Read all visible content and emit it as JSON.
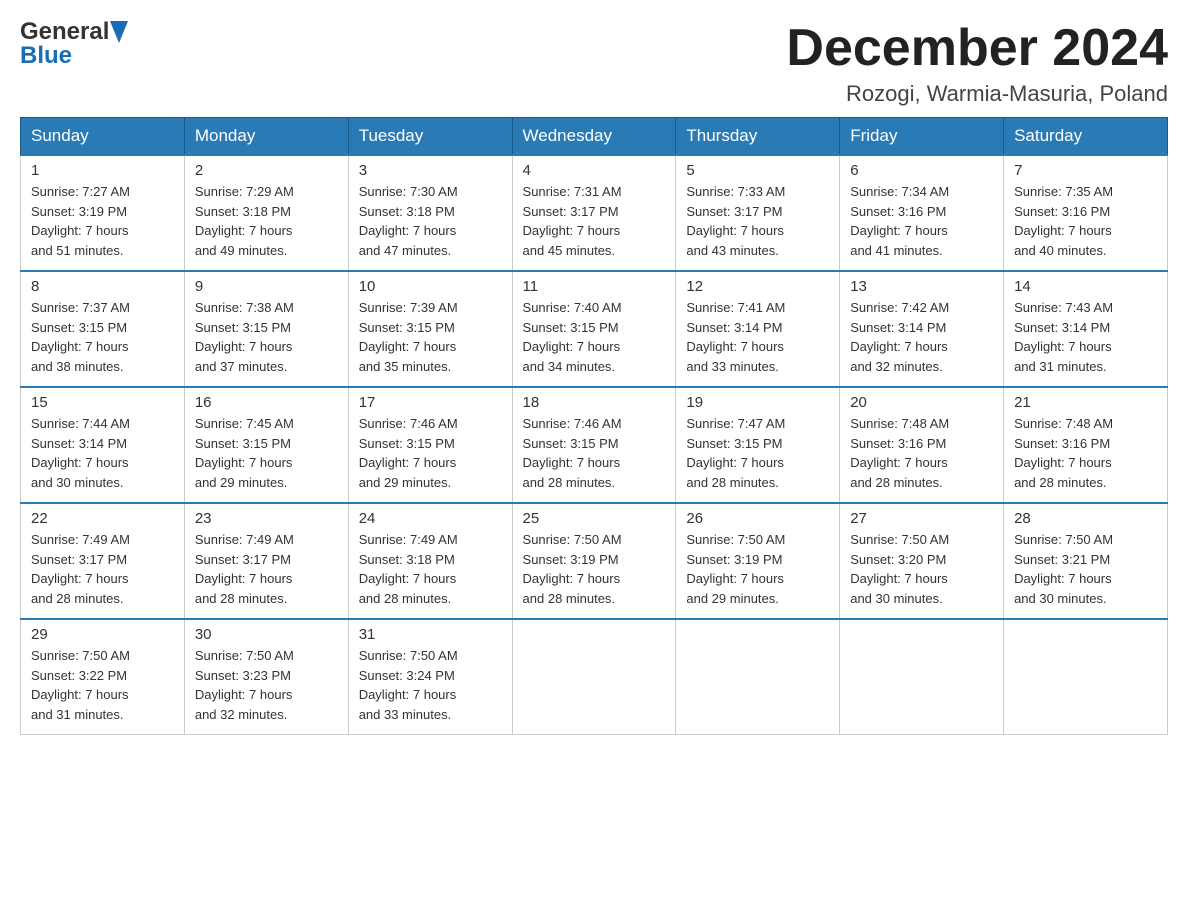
{
  "header": {
    "logo_general": "General",
    "logo_blue": "Blue",
    "month_title": "December 2024",
    "location": "Rozogi, Warmia-Masuria, Poland"
  },
  "weekdays": [
    "Sunday",
    "Monday",
    "Tuesday",
    "Wednesday",
    "Thursday",
    "Friday",
    "Saturday"
  ],
  "weeks": [
    [
      {
        "day": "1",
        "sunrise": "7:27 AM",
        "sunset": "3:19 PM",
        "daylight": "7 hours and 51 minutes."
      },
      {
        "day": "2",
        "sunrise": "7:29 AM",
        "sunset": "3:18 PM",
        "daylight": "7 hours and 49 minutes."
      },
      {
        "day": "3",
        "sunrise": "7:30 AM",
        "sunset": "3:18 PM",
        "daylight": "7 hours and 47 minutes."
      },
      {
        "day": "4",
        "sunrise": "7:31 AM",
        "sunset": "3:17 PM",
        "daylight": "7 hours and 45 minutes."
      },
      {
        "day": "5",
        "sunrise": "7:33 AM",
        "sunset": "3:17 PM",
        "daylight": "7 hours and 43 minutes."
      },
      {
        "day": "6",
        "sunrise": "7:34 AM",
        "sunset": "3:16 PM",
        "daylight": "7 hours and 41 minutes."
      },
      {
        "day": "7",
        "sunrise": "7:35 AM",
        "sunset": "3:16 PM",
        "daylight": "7 hours and 40 minutes."
      }
    ],
    [
      {
        "day": "8",
        "sunrise": "7:37 AM",
        "sunset": "3:15 PM",
        "daylight": "7 hours and 38 minutes."
      },
      {
        "day": "9",
        "sunrise": "7:38 AM",
        "sunset": "3:15 PM",
        "daylight": "7 hours and 37 minutes."
      },
      {
        "day": "10",
        "sunrise": "7:39 AM",
        "sunset": "3:15 PM",
        "daylight": "7 hours and 35 minutes."
      },
      {
        "day": "11",
        "sunrise": "7:40 AM",
        "sunset": "3:15 PM",
        "daylight": "7 hours and 34 minutes."
      },
      {
        "day": "12",
        "sunrise": "7:41 AM",
        "sunset": "3:14 PM",
        "daylight": "7 hours and 33 minutes."
      },
      {
        "day": "13",
        "sunrise": "7:42 AM",
        "sunset": "3:14 PM",
        "daylight": "7 hours and 32 minutes."
      },
      {
        "day": "14",
        "sunrise": "7:43 AM",
        "sunset": "3:14 PM",
        "daylight": "7 hours and 31 minutes."
      }
    ],
    [
      {
        "day": "15",
        "sunrise": "7:44 AM",
        "sunset": "3:14 PM",
        "daylight": "7 hours and 30 minutes."
      },
      {
        "day": "16",
        "sunrise": "7:45 AM",
        "sunset": "3:15 PM",
        "daylight": "7 hours and 29 minutes."
      },
      {
        "day": "17",
        "sunrise": "7:46 AM",
        "sunset": "3:15 PM",
        "daylight": "7 hours and 29 minutes."
      },
      {
        "day": "18",
        "sunrise": "7:46 AM",
        "sunset": "3:15 PM",
        "daylight": "7 hours and 28 minutes."
      },
      {
        "day": "19",
        "sunrise": "7:47 AM",
        "sunset": "3:15 PM",
        "daylight": "7 hours and 28 minutes."
      },
      {
        "day": "20",
        "sunrise": "7:48 AM",
        "sunset": "3:16 PM",
        "daylight": "7 hours and 28 minutes."
      },
      {
        "day": "21",
        "sunrise": "7:48 AM",
        "sunset": "3:16 PM",
        "daylight": "7 hours and 28 minutes."
      }
    ],
    [
      {
        "day": "22",
        "sunrise": "7:49 AM",
        "sunset": "3:17 PM",
        "daylight": "7 hours and 28 minutes."
      },
      {
        "day": "23",
        "sunrise": "7:49 AM",
        "sunset": "3:17 PM",
        "daylight": "7 hours and 28 minutes."
      },
      {
        "day": "24",
        "sunrise": "7:49 AM",
        "sunset": "3:18 PM",
        "daylight": "7 hours and 28 minutes."
      },
      {
        "day": "25",
        "sunrise": "7:50 AM",
        "sunset": "3:19 PM",
        "daylight": "7 hours and 28 minutes."
      },
      {
        "day": "26",
        "sunrise": "7:50 AM",
        "sunset": "3:19 PM",
        "daylight": "7 hours and 29 minutes."
      },
      {
        "day": "27",
        "sunrise": "7:50 AM",
        "sunset": "3:20 PM",
        "daylight": "7 hours and 30 minutes."
      },
      {
        "day": "28",
        "sunrise": "7:50 AM",
        "sunset": "3:21 PM",
        "daylight": "7 hours and 30 minutes."
      }
    ],
    [
      {
        "day": "29",
        "sunrise": "7:50 AM",
        "sunset": "3:22 PM",
        "daylight": "7 hours and 31 minutes."
      },
      {
        "day": "30",
        "sunrise": "7:50 AM",
        "sunset": "3:23 PM",
        "daylight": "7 hours and 32 minutes."
      },
      {
        "day": "31",
        "sunrise": "7:50 AM",
        "sunset": "3:24 PM",
        "daylight": "7 hours and 33 minutes."
      },
      null,
      null,
      null,
      null
    ]
  ]
}
